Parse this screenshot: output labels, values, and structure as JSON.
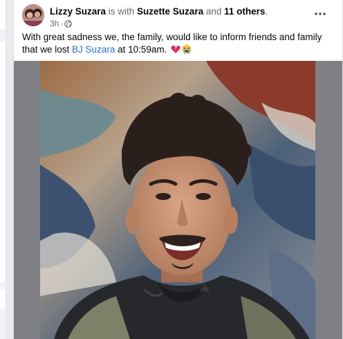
{
  "post": {
    "author": "Lizzy Suzara",
    "with_text": " is with ",
    "tagged_person": "Suzette Suzara",
    "and_text": " and ",
    "others": "11 others",
    "period": ".",
    "time": "3h",
    "dot": "·",
    "privacy_icon": "globe-icon",
    "more_icon": "more-horizontal-icon",
    "text_before_link": "With great sadness we, the family, would like to inform friends and family that we lost ",
    "linked_name": "BJ Suzara",
    "text_after_link": " at 10:59am.",
    "emojis": [
      "broken-heart-emoji",
      "crying-face-emoji"
    ]
  },
  "colors": {
    "link": "#216fdb",
    "media_bg": "#7f8085",
    "text": "#050505",
    "muted": "#65676b"
  }
}
